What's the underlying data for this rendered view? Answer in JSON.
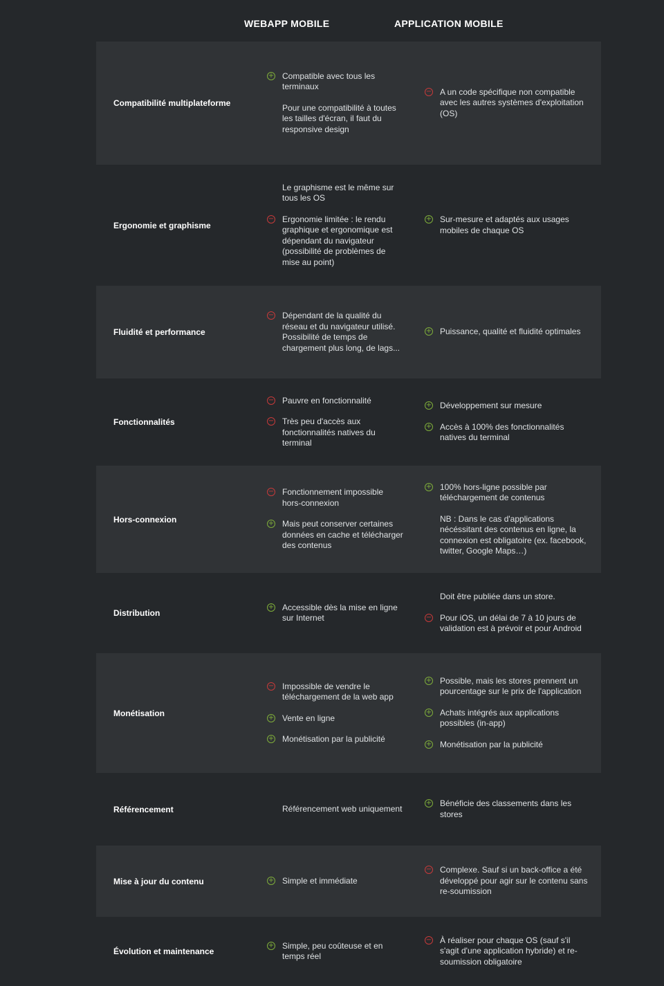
{
  "header": {
    "webapp": "WEBAPP MOBILE",
    "app": "APPLICATION MOBILE"
  },
  "rows": [
    {
      "criterion": "Compatibilité multiplateforme",
      "web": [
        {
          "type": "plus",
          "text": "Compatible avec tous les terminaux"
        },
        {
          "type": "none",
          "text": "Pour une compatibilité à toutes les tailles d'écran, il faut du responsive design"
        }
      ],
      "app": [
        {
          "type": "minus",
          "text": "A un code spécifique non compatible avec les autres systèmes d'exploitation (OS)"
        }
      ]
    },
    {
      "criterion": "Ergonomie et graphisme",
      "web": [
        {
          "type": "none",
          "text": "Le graphisme est le même sur tous les OS"
        },
        {
          "type": "minus",
          "text": "Ergonomie limitée : le rendu graphique et ergonomique est dépendant du navigateur (possibilité de problèmes de mise au point)"
        }
      ],
      "app": [
        {
          "type": "plus",
          "text": "Sur-mesure et adaptés aux usages mobiles de chaque OS"
        }
      ]
    },
    {
      "criterion": "Fluidité et performance",
      "web": [
        {
          "type": "minus",
          "text": "Dépendant de la qualité du réseau et du navigateur utilisé. Possibilité de temps de chargement plus long, de lags..."
        }
      ],
      "app": [
        {
          "type": "plus",
          "text": "Puissance, qualité et fluidité optimales"
        }
      ]
    },
    {
      "criterion": "Fonctionnalités",
      "web": [
        {
          "type": "minus",
          "text": "Pauvre en fonctionnalité"
        },
        {
          "type": "minus",
          "text": "Très peu d'accès aux fonctionnalités natives du terminal"
        }
      ],
      "app": [
        {
          "type": "plus",
          "text": "Développement sur mesure"
        },
        {
          "type": "plus",
          "text": "Accès à 100% des fonctionnalités natives du terminal"
        }
      ]
    },
    {
      "criterion": "Hors-connexion",
      "web": [
        {
          "type": "minus",
          "text": "Fonctionnement impossible hors-connexion"
        },
        {
          "type": "plus",
          "text": "Mais peut conserver certaines données en cache et télécharger des contenus"
        }
      ],
      "app": [
        {
          "type": "plus",
          "text": "100% hors-ligne possible par téléchargement de contenus"
        },
        {
          "type": "none",
          "text": "NB : Dans le cas d'applications nécéssitant des contenus en ligne, la connexion est obligatoire (ex. facebook, twitter, Google Maps…)"
        }
      ]
    },
    {
      "criterion": "Distribution",
      "web": [
        {
          "type": "plus",
          "text": "Accessible dès la mise en ligne sur Internet"
        }
      ],
      "app": [
        {
          "type": "none",
          "text": "Doit être publiée dans un store."
        },
        {
          "type": "minus",
          "text": "Pour iOS, un délai de 7 à 10 jours de validation est à prévoir et pour Android"
        }
      ]
    },
    {
      "criterion": "Monétisation",
      "web": [
        {
          "type": "minus",
          "text": "Impossible de vendre le téléchargement de la web app"
        },
        {
          "type": "plus",
          "text": "Vente en ligne"
        },
        {
          "type": "plus",
          "text": "Monétisation par la publicité"
        }
      ],
      "app": [
        {
          "type": "plus",
          "text": "Possible, mais les stores prennent un pourcentage sur le prix de l'application"
        },
        {
          "type": "plus",
          "text": "Achats intégrés aux applications possibles (in-app)"
        },
        {
          "type": "plus",
          "text": "Monétisation par la publicité"
        }
      ]
    },
    {
      "criterion": "Référencement",
      "web": [
        {
          "type": "none",
          "text": "Référencement web uniquement"
        }
      ],
      "app": [
        {
          "type": "plus",
          "text": "Bénéficie des classements dans les stores"
        }
      ]
    },
    {
      "criterion": "Mise à jour du contenu",
      "web": [
        {
          "type": "plus",
          "text": "Simple et immédiate"
        }
      ],
      "app": [
        {
          "type": "minus",
          "text": "Complexe. Sauf si un back-office a été développé pour agir sur le contenu sans re-soumission"
        }
      ]
    },
    {
      "criterion": "Évolution et maintenance",
      "web": [
        {
          "type": "plus",
          "text": "Simple, peu coûteuse et en temps réel"
        }
      ],
      "app": [
        {
          "type": "minus",
          "text": "À réaliser pour chaque OS (sauf s'il s'agit d'une application hybride) et re-soumission obligatoire"
        }
      ]
    }
  ],
  "colors": {
    "plus": "#7fae3a",
    "minus": "#c83a3a",
    "band": "#303336",
    "background": "#25282b"
  }
}
